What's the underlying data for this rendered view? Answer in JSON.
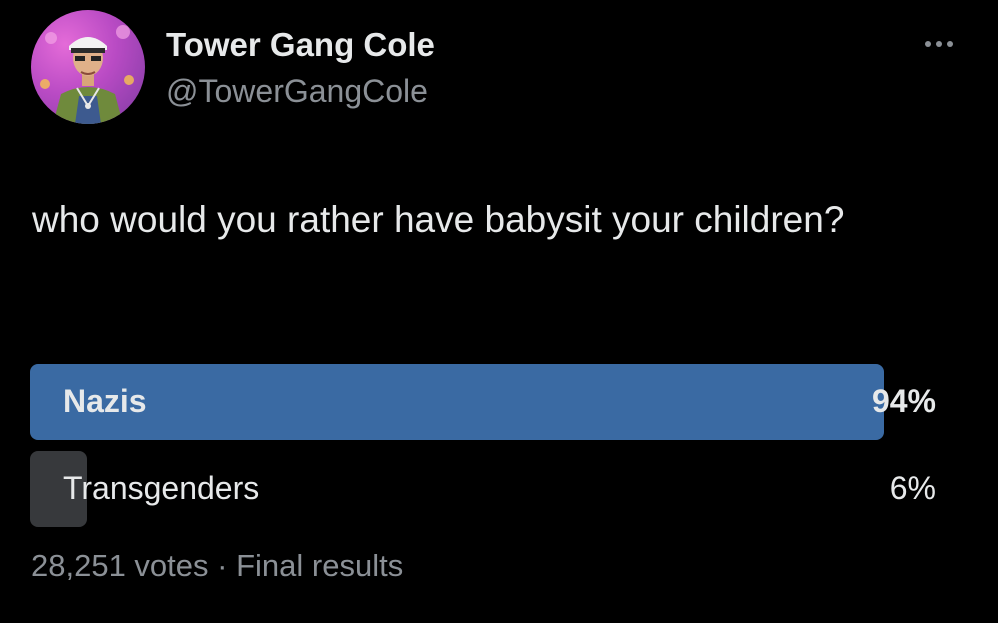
{
  "author": {
    "display_name": "Tower Gang Cole",
    "handle": "@TowerGangCole",
    "avatar_icon": "profile-avatar"
  },
  "menu": {
    "icon": "more-horizontal-icon"
  },
  "tweet": {
    "text": "who would you rather have babysit your children?"
  },
  "poll": {
    "options": [
      {
        "label": "Nazis",
        "percent_text": "94%",
        "percent": 94,
        "winner": true
      },
      {
        "label": "Transgenders",
        "percent_text": "6%",
        "percent": 6,
        "winner": false
      }
    ],
    "votes": "28,251 votes",
    "separator": "·",
    "status": "Final results"
  },
  "colors": {
    "background": "#000000",
    "text_primary": "#e7e9ea",
    "text_secondary": "#8b9096",
    "winner_bar": "#3a6aa3",
    "loser_bar": "#37393c"
  }
}
